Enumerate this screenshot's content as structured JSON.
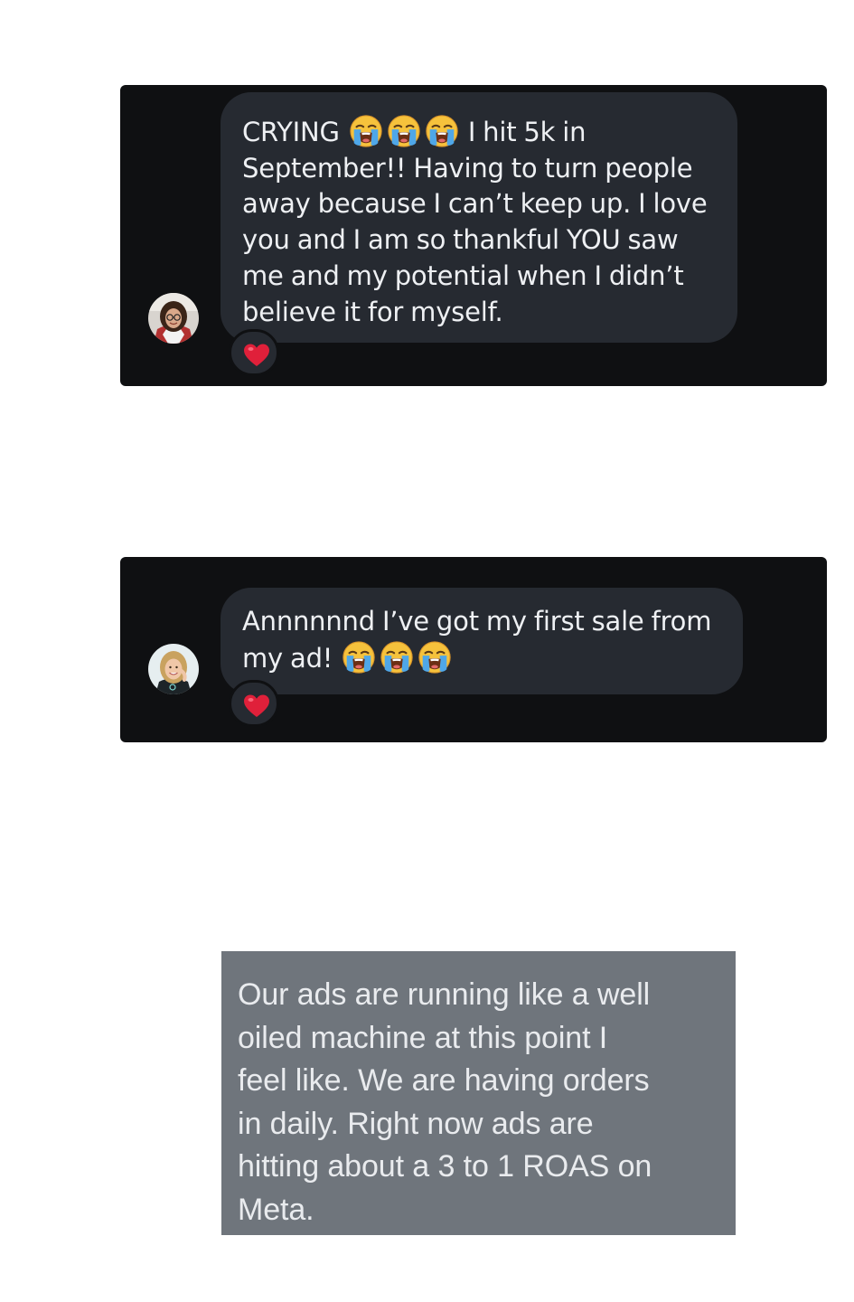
{
  "messages": [
    {
      "segments": [
        {
          "text": "CRYING "
        },
        {
          "emoji": "loudly-crying-face"
        },
        {
          "emoji": "loudly-crying-face"
        },
        {
          "emoji": "loudly-crying-face"
        },
        {
          "text": " I hit 5k in"
        }
      ],
      "lines": [
        "September!! Having to turn people",
        "away because I can’t keep up. I love",
        "you and I am so thankful YOU saw",
        "me and my potential when I didn’t",
        "believe it for myself."
      ],
      "reaction": "red-heart",
      "avatar": "avatar-woman-glasses"
    },
    {
      "lines": [
        "Annnnnnd I’ve got my first sale from"
      ],
      "segments": [
        {
          "text": "my ad! "
        },
        {
          "emoji": "loudly-crying-face"
        },
        {
          "emoji": "loudly-crying-face"
        },
        {
          "emoji": "loudly-crying-face"
        }
      ],
      "reaction": "red-heart",
      "avatar": "avatar-woman-blonde"
    }
  ],
  "screenshot_text": {
    "lines": [
      "Our ads are running like a well",
      "oiled machine at this point I",
      "feel like. We are having orders",
      "in daily. Right now ads are",
      "hitting about a 3 to 1 ROAS on",
      "Meta."
    ]
  },
  "colors": {
    "card_bg": "#0f1012",
    "bubble_bg": "#262a31",
    "bubble_text": "#eef0f3",
    "screenshot_bg": "#6f757c",
    "heart": "#e0203a"
  }
}
